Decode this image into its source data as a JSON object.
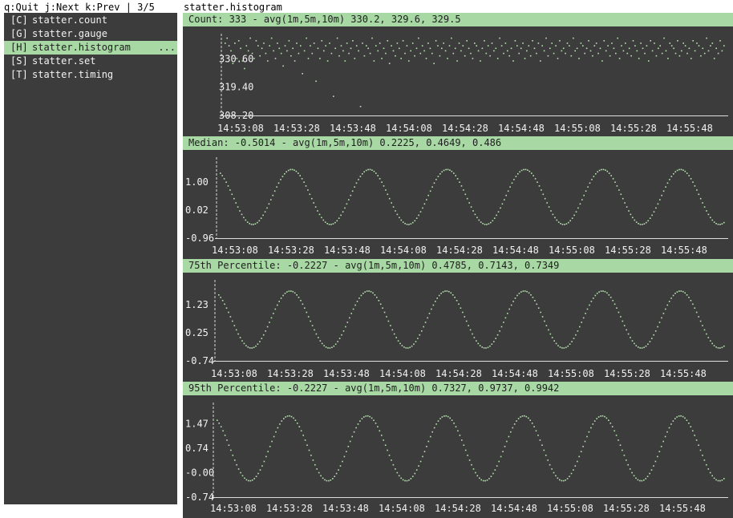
{
  "statusbar": {
    "text": "q:Quit j:Next k:Prev | 3/5"
  },
  "sidebar": {
    "items": [
      {
        "key": "[C]",
        "label": "statter.count",
        "selected": false
      },
      {
        "key": "[G]",
        "label": "statter.gauge",
        "selected": false
      },
      {
        "key": "[H]",
        "label": "statter.histogram",
        "selected": true,
        "ellipsis": "..."
      },
      {
        "key": "[S]",
        "label": "statter.set",
        "selected": false
      },
      {
        "key": "[T]",
        "label": "statter.timing",
        "selected": false
      }
    ]
  },
  "main": {
    "title": "statter.histogram"
  },
  "colors": {
    "accent": "#a8d9a4",
    "panel_bg": "#3c3c3c",
    "point": "#b7e3b0",
    "text": "#f2f2f2"
  },
  "chart_data": [
    {
      "type": "scatter",
      "title": "Count: 333 - avg(1m,5m,10m) 330.2, 329.6, 329.5",
      "x_tick_labels": [
        "14:53:08",
        "14:53:28",
        "14:53:48",
        "14:54:08",
        "14:54:28",
        "14:54:48",
        "14:55:08",
        "14:55:28",
        "14:55:48"
      ],
      "y_tick_labels": [
        "330.60",
        "319.40",
        "308.20"
      ],
      "y_ticks": [
        330.6,
        319.4,
        308.2
      ],
      "ylim": [
        308.2,
        341.8
      ],
      "series": [
        {
          "values": [
            337,
            339,
            336,
            334,
            329,
            337,
            331,
            338,
            335,
            330,
            327,
            336,
            334,
            339,
            333,
            331,
            338,
            336,
            332,
            335,
            337,
            333,
            330,
            336,
            339,
            334,
            331,
            337,
            335,
            333,
            328,
            336,
            334,
            338,
            332,
            335,
            330,
            337,
            333,
            336,
            325,
            334,
            339,
            331,
            336,
            333,
            337,
            322,
            335,
            331,
            338,
            334,
            336,
            330,
            337,
            333,
            316,
            335,
            339,
            332,
            336,
            334,
            330,
            337,
            333,
            335,
            338,
            331,
            336,
            334,
            312,
            337,
            332,
            336,
            335,
            333,
            339,
            330,
            336,
            334,
            337,
            331,
            335,
            333,
            338,
            329,
            336,
            334,
            332,
            337,
            335,
            331,
            338,
            333,
            336,
            330,
            334,
            337,
            332,
            335,
            339,
            333,
            336,
            334,
            331,
            337,
            335,
            333,
            329,
            338,
            336,
            332,
            335,
            337,
            334,
            331,
            336,
            339,
            333,
            335,
            330,
            337,
            334,
            336,
            332,
            338,
            335,
            333,
            331,
            337,
            336,
            334,
            330,
            335,
            338,
            333,
            336,
            332,
            337,
            334,
            335,
            331,
            339,
            336,
            333,
            337,
            334,
            332,
            335,
            330,
            338,
            336,
            333,
            335,
            337,
            331,
            334,
            336,
            332,
            338,
            335,
            333,
            337,
            330,
            336,
            334,
            339,
            332,
            335,
            337,
            333,
            336,
            331,
            338,
            334,
            335,
            333,
            337,
            336,
            332,
            339,
            334,
            335,
            331,
            337,
            336,
            333,
            335,
            338,
            334,
            332,
            336,
            337,
            333,
            335,
            330,
            338,
            334,
            336,
            332,
            337,
            335,
            333,
            339,
            331,
            336,
            334,
            337,
            333,
            335,
            332,
            338,
            336,
            334,
            331,
            337,
            335,
            333,
            336,
            330,
            338,
            334,
            337,
            332,
            335,
            336,
            333,
            339,
            334,
            331,
            337,
            336,
            335,
            333,
            338,
            332,
            334,
            337,
            336,
            333,
            335,
            331,
            338,
            334,
            337,
            336,
            332,
            335,
            333,
            339,
            334,
            336,
            337,
            331,
            335,
            333,
            338,
            334,
            336
          ]
        }
      ]
    },
    {
      "type": "scatter",
      "title": "Median: -0.5014 - avg(1m,5m,10m) 0.2225, 0.4649, 0.486",
      "x_tick_labels": [
        "14:53:08",
        "14:53:28",
        "14:53:48",
        "14:54:08",
        "14:54:28",
        "14:54:48",
        "14:55:08",
        "14:55:28",
        "14:55:48"
      ],
      "y_tick_labels": [
        "1.00",
        "0.02",
        "-0.96"
      ],
      "y_ticks": [
        1.0,
        0.02,
        -0.96
      ],
      "ylim": [
        -0.96,
        1.98
      ],
      "series": [
        {
          "wave": {
            "period": 20,
            "phase": 2.1,
            "amp": 0.96,
            "mid": 0.5,
            "points": 260
          }
        }
      ]
    },
    {
      "type": "scatter",
      "title": "75th Percentile: -0.2227 - avg(1m,5m,10m) 0.4785, 0.7143, 0.7349",
      "x_tick_labels": [
        "14:53:08",
        "14:53:28",
        "14:53:48",
        "14:54:08",
        "14:54:28",
        "14:54:48",
        "14:55:08",
        "14:55:28",
        "14:55:48"
      ],
      "y_tick_labels": [
        "1.23",
        "0.25",
        "-0.74"
      ],
      "y_ticks": [
        1.23,
        0.25,
        -0.74
      ],
      "ylim": [
        -0.74,
        2.21
      ],
      "series": [
        {
          "wave": {
            "period": 20,
            "phase": 2.1,
            "amp": 1.0,
            "mid": 0.73,
            "points": 260
          }
        }
      ]
    },
    {
      "type": "scatter",
      "title": "95th Percentile: -0.2227 - avg(1m,5m,10m) 0.7327, 0.9737, 0.9942",
      "x_tick_labels": [
        "14:53:08",
        "14:53:28",
        "14:53:48",
        "14:54:08",
        "14:54:28",
        "14:54:48",
        "14:55:08",
        "14:55:28",
        "14:55:48"
      ],
      "y_tick_labels": [
        "1.47",
        "0.74",
        "-0.00",
        "-0.74"
      ],
      "y_ticks": [
        1.47,
        0.74,
        0.0,
        -0.74
      ],
      "ylim": [
        -0.74,
        2.21
      ],
      "series": [
        {
          "wave": {
            "period": 20,
            "phase": 2.1,
            "amp": 0.98,
            "mid": 0.75,
            "points": 260
          }
        }
      ]
    }
  ]
}
